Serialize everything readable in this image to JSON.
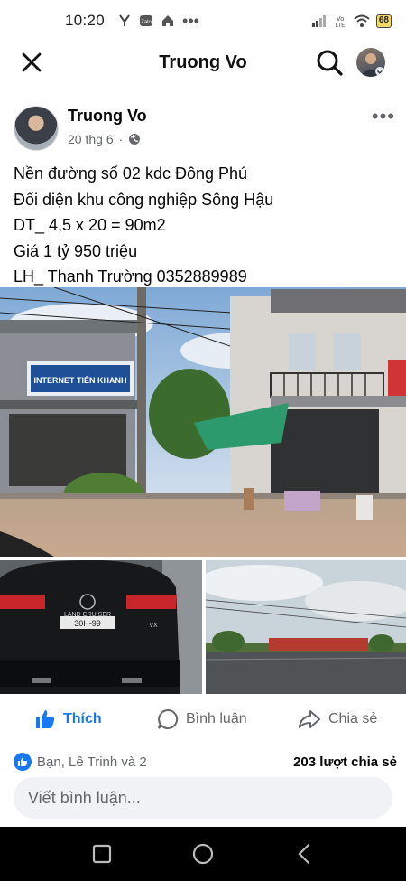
{
  "status_bar": {
    "time": "10:20",
    "battery": "68"
  },
  "header": {
    "title": "Truong Vo"
  },
  "post": {
    "author": "Truong Vo",
    "date": "20 thg 6",
    "lines": [
      "Nền đường số 02 kdc Đông Phú",
      "Đối diện khu công nghiệp Sông Hậu",
      "DT_ 4,5 x 20 = 90m2",
      "Giá 1 tỷ 950 triệu",
      "LH_ Thanh Trường 0352889989"
    ],
    "photo_main": {
      "sign_text": "INTERNET TIẾN KHANH"
    },
    "photo_car": {
      "plate": "30H-99",
      "badge": "LAND CRUISER",
      "badge_2": "VX"
    }
  },
  "actions": {
    "like": "Thích",
    "comment": "Bình luận",
    "share": "Chia sẻ"
  },
  "reactions": {
    "summary": "Bạn, Lê Trinh và 2",
    "shares": "203 lượt chia sẻ"
  },
  "comment_box": {
    "placeholder": "Viết bình luận..."
  },
  "colors": {
    "accent": "#1877f2",
    "secondary_text": "#65676b"
  }
}
